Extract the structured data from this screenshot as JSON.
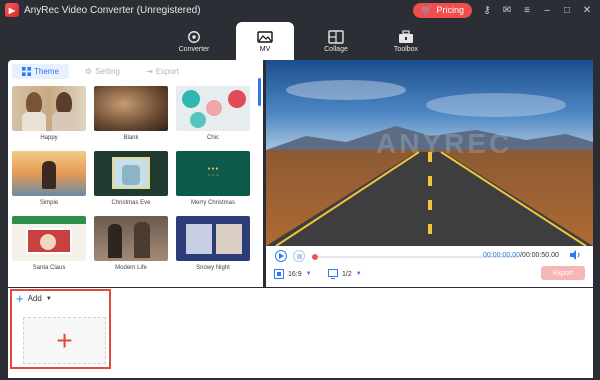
{
  "app": {
    "title": "AnyRec Video Converter (Unregistered)",
    "pricing_label": "Pricing"
  },
  "nav": {
    "tabs": [
      {
        "label": "Converter",
        "active": false
      },
      {
        "label": "MV",
        "active": true
      },
      {
        "label": "Collage",
        "active": false
      },
      {
        "label": "Toolbox",
        "active": false
      }
    ]
  },
  "subtabs": {
    "theme": "Theme",
    "setting": "Setting",
    "export": "Export"
  },
  "themes": [
    {
      "label": "Happy"
    },
    {
      "label": "Blank"
    },
    {
      "label": "Chic"
    },
    {
      "label": "Simple"
    },
    {
      "label": "Christmas Eve"
    },
    {
      "label": "Merry Christmas"
    },
    {
      "label": "Santa Claus"
    },
    {
      "label": "Modern Life"
    },
    {
      "label": "Snowy Night"
    }
  ],
  "preview": {
    "watermark": "ANYREC",
    "time_current": "00:00:00.00",
    "time_total": "/00:00:50.00",
    "aspect_ratio": "16:9",
    "page": "1/2",
    "export_label": "Export"
  },
  "bottom": {
    "add_label": "Add"
  },
  "colors": {
    "accent": "#2d7bf0",
    "highlight": "#e14a3c",
    "pricing": "#f04d4d"
  }
}
